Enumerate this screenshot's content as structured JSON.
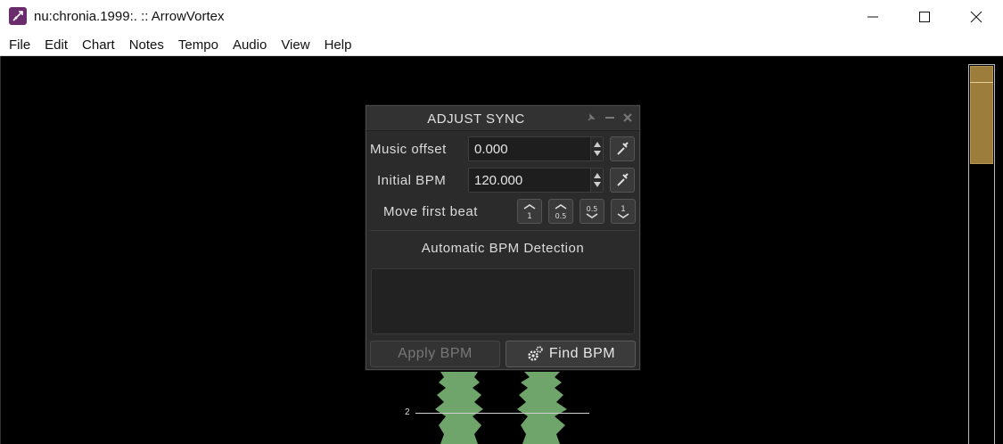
{
  "window": {
    "title": "nu:chronia.1999:. :: ArrowVortex"
  },
  "menu": [
    "File",
    "Edit",
    "Chart",
    "Notes",
    "Tempo",
    "Audio",
    "View",
    "Help"
  ],
  "dialog": {
    "title": "ADJUST SYNC",
    "music_offset_label": "Music offset",
    "music_offset_value": "0.000",
    "initial_bpm_label": "Initial BPM",
    "initial_bpm_value": "120.000",
    "move_first_beat_label": "Move first beat",
    "move_buttons": [
      "1",
      "0.5",
      "0.5",
      "1"
    ],
    "auto_bpm_title": "Automatic BPM Detection",
    "apply_bpm_label": "Apply BPM",
    "find_bpm_label": "Find BPM"
  },
  "waveform": {
    "beat_label": "2",
    "color": "#6fa56a"
  },
  "colors": {
    "scroll_thumb": "#9c7d3c",
    "dialog_bg": "#2b2b2b"
  }
}
